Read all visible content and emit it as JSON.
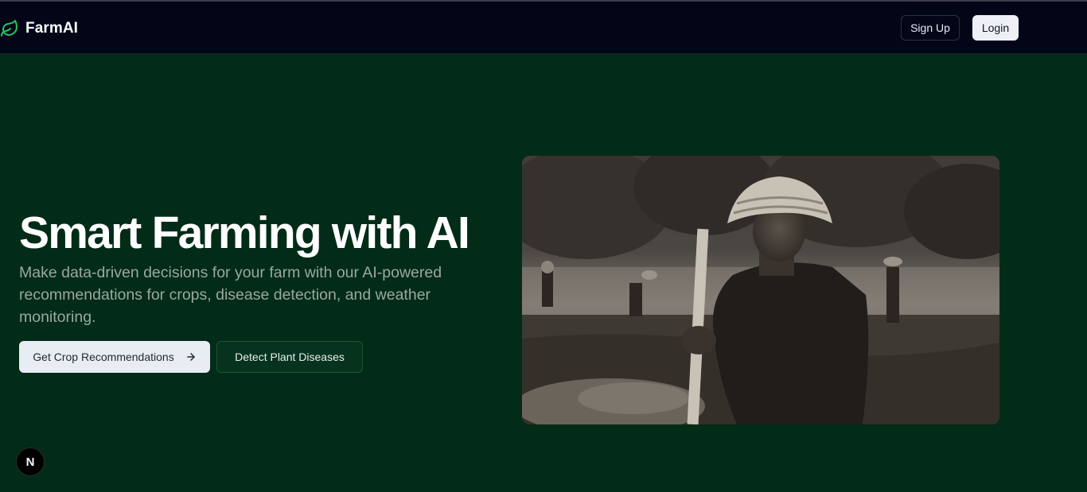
{
  "header": {
    "brand_name": "FarmAI",
    "brand_icon": "leaf-icon",
    "signup_label": "Sign Up",
    "login_label": "Login"
  },
  "hero": {
    "title": "Smart Farming with AI",
    "subtitle": "Make data-driven decisions for your farm with our AI-powered recommendations for crops, disease detection, and weather monitoring.",
    "primary_button": "Get Crop Recommendations",
    "primary_button_icon": "arrow-right-icon",
    "secondary_button": "Detect Plant Diseases",
    "image_description_icon": "hero-photo"
  },
  "dev_indicator": {
    "label": "N"
  },
  "colors": {
    "background": "#022c17",
    "navbar": "#030617",
    "accent_green": "#22c55e",
    "primary_button_bg": "#e8ecf3"
  }
}
